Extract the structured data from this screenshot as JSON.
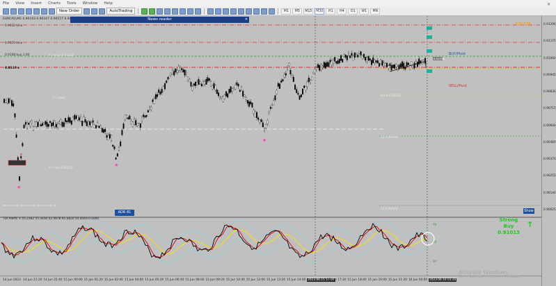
{
  "menu": {
    "items": [
      "File",
      "View",
      "Insert",
      "Charts",
      "Tools",
      "Window",
      "Help"
    ]
  },
  "toolbar": {
    "new_order_label": "New Order",
    "autotrading_label": "AutoTrading",
    "timeframes": [
      "M1",
      "M5",
      "M15",
      "M30",
      "H1",
      "H4",
      "D1",
      "W1",
      "MN"
    ],
    "active_timeframe": "M30"
  },
  "chart": {
    "symbol_label": "EURCAD,M5  0.90163  0.90167  0.90157  0.90158",
    "news_label": "News reader",
    "line_labels": {
      "r3": "0.9132 Line",
      "r2": "0.9125 Line",
      "r1": "0.9108 buy 3.00",
      "s_main": "0.9110 s",
      "buy_pivot": "BUY/Pivot",
      "sell_pivot": "SELL/Pivot",
      "pivot_label": "Pivot 0.90743",
      "s1_label": "S1 0.90480",
      "s2_label": "S2 0.90040",
      "ys_open": "Y's Open",
      "ys_low": "Y's Low 0.90272",
      "ys_high": "Y's High 0.91133",
      "top_right": "0.91158",
      "right_box": "0.91078"
    },
    "atr_label": "ADR 81",
    "show_button": "Show",
    "indicator_label": "TDI Alerts +  55.2382 55.3430 42.5678 61.0820 54.4043 0.0000",
    "indicator_levels": [
      "70",
      "50",
      "30"
    ],
    "signal": {
      "text": "Strong Buy",
      "price": "0.91013",
      "arrow": "↑"
    },
    "watermark_title": "Activate Windows",
    "watermark_sub": "Go to Settings to activate Windows.",
    "price_axis": [
      "0.91290",
      "0.91175",
      "0.91060",
      "0.90945",
      "0.90830",
      "0.90715",
      "0.90600",
      "0.90485",
      "0.90370",
      "0.90255",
      "0.90140",
      "0.90025"
    ],
    "time_axis": [
      "14 Jun 2023",
      "14 Jun 21:20",
      "14 Jun 22:40",
      "15 Jun 00:00",
      "15 Jun 01:20",
      "15 Jun 02:40",
      "15 Jun 04:00",
      "15 Jun 05:20",
      "15 Jun 06:40",
      "15 Jun 08:00",
      "15 Jun 09:20",
      "15 Jun 10:40",
      "15 Jun 12:00",
      "15 Jun 13:20",
      "15 Jun 14:40",
      "2023.06.15 16:00",
      "15 Jun 17:20",
      "15 Jun 18:40",
      "15 Jun 20:00",
      "15 Jun 21:20",
      "16 Jun 00:00",
      "2023.06.16 01:20"
    ]
  },
  "colors": {
    "chart_bg": "#c0c0c0",
    "resistance": "#e03030",
    "support": "#2c9d2c",
    "candle": "#000000",
    "rsi_red": "#e00000",
    "rsi_yellow": "#f5e400",
    "band_blue": "#7fd4ec",
    "signal_green": "#1fc71f"
  }
}
